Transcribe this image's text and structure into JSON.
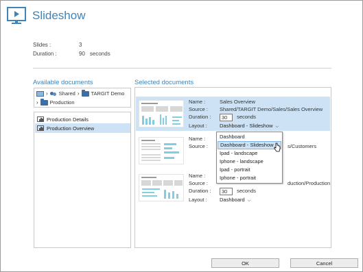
{
  "header": {
    "title": "Slideshow",
    "icon": "monitor-play-icon"
  },
  "info": {
    "slides_label": "Slides :",
    "slides_value": "3",
    "duration_label": "Duration :",
    "duration_value": "90",
    "duration_unit": "seconds"
  },
  "available": {
    "title": "Available documents",
    "breadcrumb": {
      "shared": "Shared",
      "targit": "TARGIT Demo",
      "production": "Production"
    },
    "items": [
      {
        "label": "Production Details",
        "selected": false
      },
      {
        "label": "Production Overview",
        "selected": true
      }
    ]
  },
  "selected": {
    "title": "Selected documents",
    "entries": [
      {
        "name_label": "Name :",
        "name": "Sales Overview",
        "source_label": "Source :",
        "source": "Shared/TARGIT Demo/Sales/Sales Overview",
        "duration_label": "Duration :",
        "duration": "30",
        "unit": "seconds",
        "layout_label": "Layout :",
        "layout": "Dashboard - Slideshow",
        "selected": true
      },
      {
        "name_label": "Name :",
        "source_label": "Source :",
        "source_tail": "s/Customers"
      },
      {
        "name_label": "Name :",
        "source_label": "Source :",
        "source_tail": "duction/Production",
        "duration_label": "Duration :",
        "duration": "30",
        "unit": "seconds",
        "layout_label": "Layout :",
        "layout": "Dashboard"
      }
    ]
  },
  "dropdown": {
    "options": [
      "Dashboard",
      "Dashboard - Slideshow",
      "Ipad - landscape",
      "Iphone - landscape",
      "Ipad - portrait",
      "Iphone - portrait"
    ],
    "hovered": "Dashboard - Slideshow"
  },
  "buttons": {
    "ok": "OK",
    "cancel": "Cancel"
  },
  "colors": {
    "accent": "#3f83b8",
    "selection": "#cde3f5"
  }
}
